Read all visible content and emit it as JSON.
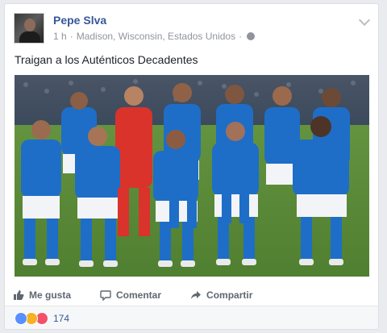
{
  "post": {
    "author_name": "Pepe Slva",
    "time": "1 h",
    "separator": "·",
    "location": "Madison, Wisconsin, Estados Unidos",
    "separator2": "·",
    "text": "Traigan a los Auténticos Decadentes"
  },
  "actions": {
    "like_label": "Me gusta",
    "comment_label": "Comentar",
    "share_label": "Compartir"
  },
  "reactions": {
    "count": "174",
    "types": [
      "like-icon",
      "haha-icon",
      "love-icon"
    ]
  },
  "colors": {
    "link": "#365899",
    "meta": "#90949c",
    "action": "#606770",
    "jersey": "#1e6ec8",
    "keeper": "#d9332b",
    "grass": "#5c8a3a"
  }
}
